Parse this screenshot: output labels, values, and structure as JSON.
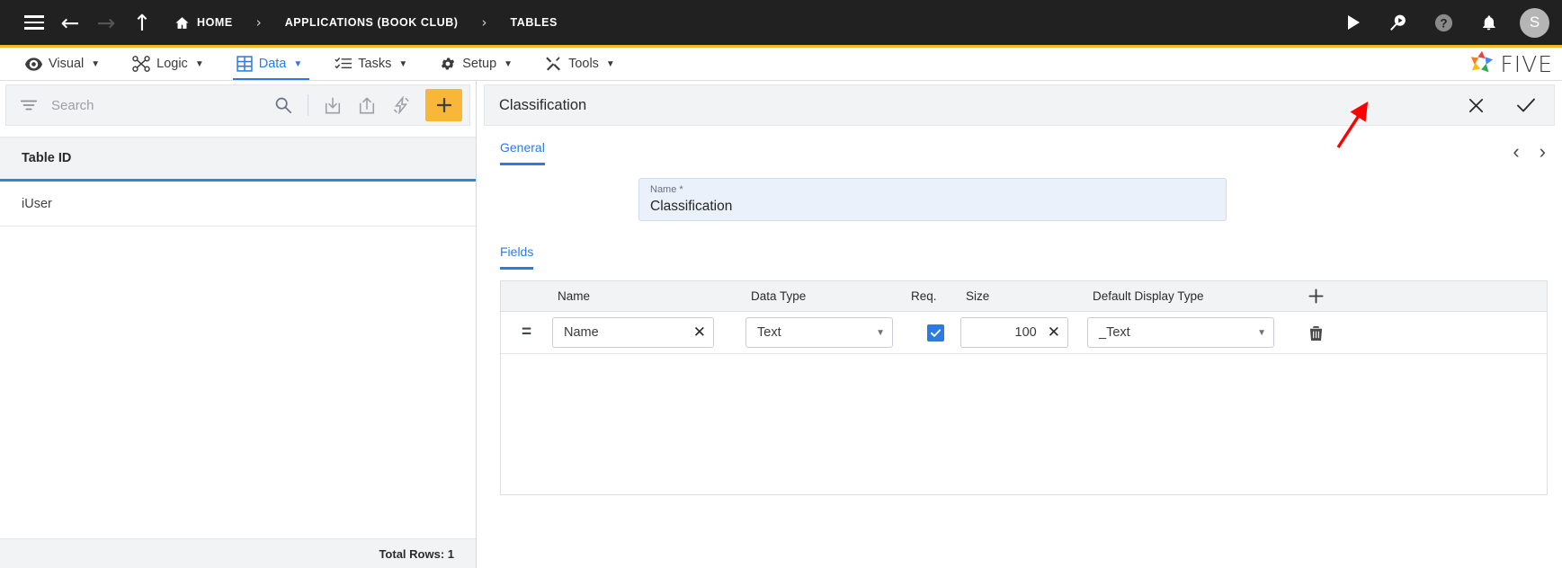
{
  "topbar": {
    "menu_icon": "hamburger-icon",
    "back_icon": "arrow-left-icon",
    "forward_icon": "arrow-right-icon",
    "up_icon": "arrow-up-icon",
    "breadcrumb": [
      {
        "label": "HOME",
        "icon": "home-icon"
      },
      {
        "label": "APPLICATIONS (BOOK CLUB)",
        "icon": ""
      },
      {
        "label": "TABLES",
        "icon": ""
      }
    ],
    "separator": "›",
    "actions": [
      {
        "name": "run-icon",
        "glyph": "▶"
      },
      {
        "name": "search-play-icon",
        "glyph": ""
      },
      {
        "name": "help-icon",
        "glyph": "?"
      },
      {
        "name": "notifications-bell-icon",
        "glyph": ""
      }
    ],
    "avatar_initial": "S",
    "avatar_color": "#b5b5b5",
    "background": "#212121"
  },
  "menubar": {
    "accent_color": "#f6b72b",
    "active_color": "#2c7be5",
    "items": [
      {
        "label": "Visual",
        "icon": "eye-icon",
        "caret": "▼",
        "active": false
      },
      {
        "label": "Logic",
        "icon": "logic-nodes-icon",
        "caret": "▼",
        "active": false
      },
      {
        "label": "Data",
        "icon": "table-grid-icon",
        "caret": "▼",
        "active": true
      },
      {
        "label": "Tasks",
        "icon": "checklist-icon",
        "caret": "▼",
        "active": false
      },
      {
        "label": "Setup",
        "icon": "gear-icon",
        "caret": "▼",
        "active": false
      },
      {
        "label": "Tools",
        "icon": "tools-wrench-icon",
        "caret": "▼",
        "active": false
      }
    ],
    "logo_text": "FIVE",
    "logo_icon": "five-star-logo-icon"
  },
  "left_panel": {
    "search": {
      "placeholder": "Search",
      "value": "",
      "filter_icon": "filter-icon",
      "search_icon": "search-icon"
    },
    "toolbar_icons": [
      {
        "name": "import-icon"
      },
      {
        "name": "export-icon"
      },
      {
        "name": "quick-action-lightning-icon"
      }
    ],
    "add_button": {
      "name": "add-record-button",
      "glyph": "+",
      "color": "#f8b738"
    },
    "column_header": "Table ID",
    "rows": [
      {
        "table_id": "iUser"
      }
    ],
    "footer_text": "Total Rows: 1"
  },
  "right_panel": {
    "title": "Classification",
    "close_label": "✕",
    "confirm_label": "✓",
    "prev_label": "‹",
    "next_label": "›",
    "tabs": [
      {
        "label": "General",
        "active": true
      }
    ],
    "name_field": {
      "label": "Name *",
      "value": "Classification"
    },
    "fields_section": {
      "tab_label": "Fields",
      "columns": [
        "Name",
        "Data Type",
        "Req.",
        "Size",
        "Default Display Type"
      ],
      "add_row_glyph": "+",
      "rows": [
        {
          "handle": "drag-handle",
          "name": "Name",
          "name_clear": "✕",
          "data_type": "Text",
          "required": true,
          "size": "100",
          "size_clear": "✕",
          "default_display_type": "_Text",
          "delete_icon": "trash-icon"
        }
      ]
    }
  },
  "annotation": {
    "arrow_color": "#ff0000",
    "points_to": "confirm-checkmark-button"
  }
}
